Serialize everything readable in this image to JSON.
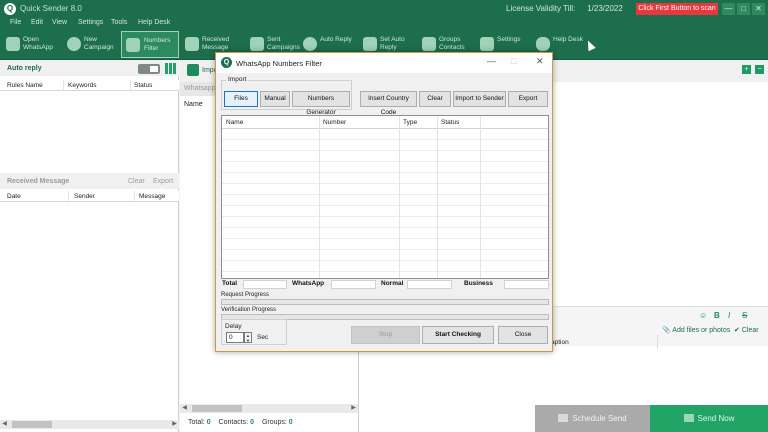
{
  "app": {
    "title": "Quick Sender 8.0",
    "logo_letter": "Q",
    "license_label": "License Validity Till:",
    "license_date": "1/23/2022",
    "scan_button": "Click First Button to scan",
    "window_controls": [
      "—",
      "□",
      "✕"
    ]
  },
  "menu": [
    "File",
    "Edit",
    "View",
    "Settings",
    "Tools",
    "Help Desk"
  ],
  "toolbar": {
    "items": [
      {
        "label": "Open\nWhatsApp",
        "icon": "qr-icon"
      },
      {
        "label": "New\nCampaign",
        "icon": "plus-circle-icon"
      },
      {
        "label": "Numbers\nFilter",
        "icon": "filter-icon"
      },
      {
        "label": "Received\nMessage",
        "icon": "inbox-icon"
      },
      {
        "label": "Sent\nCampaigns",
        "icon": "sent-icon"
      },
      {
        "label": "Auto Reply",
        "icon": "headset-icon"
      },
      {
        "label": "Set Auto\nReply",
        "icon": "settings-reply-icon"
      },
      {
        "label": "Groups\nContacts",
        "icon": "groups-icon"
      },
      {
        "label": "Settings",
        "icon": "sliders-icon"
      },
      {
        "label": "Help Desk",
        "icon": "cloud-icon"
      }
    ]
  },
  "left_panel": {
    "auto_reply": {
      "title": "Auto reply",
      "columns": [
        "Rules Name",
        "Keywords",
        "Status"
      ]
    },
    "received": {
      "title": "Received Message",
      "clear": "Clear",
      "export": "Export",
      "columns": [
        "Date",
        "Sender",
        "Message"
      ]
    }
  },
  "middle_panel": {
    "import_label": "Impo",
    "whatsapp_label": "Whatsapp",
    "name_label": "Name",
    "footer": {
      "total_label": "Total:",
      "total_value": "0",
      "contacts_label": "Contacts:",
      "contacts_value": "0",
      "groups_label": "Groups:",
      "groups_value": "0"
    }
  },
  "right_panel": {
    "format_icons": [
      "☺",
      "B",
      "I",
      "S"
    ],
    "attach": "Add files or photos",
    "clear": "Clear",
    "caption": "aption",
    "schedule": "Schedule Send",
    "send": "Send Now"
  },
  "dialog": {
    "title": "WhatsApp Numbers Filter",
    "controls": [
      "—",
      "□",
      "✕"
    ],
    "import_group": "Import",
    "buttons": {
      "files": "Files",
      "manual": "Manual",
      "generator": "Numbers Generator",
      "insert_code": "Insert Country Code",
      "clear": "Clear",
      "import_sender": "Import to Sender",
      "export": "Export",
      "stop": "Stop",
      "start": "Start Checking",
      "close": "Close"
    },
    "columns": [
      "Name",
      "Number",
      "Type",
      "Status"
    ],
    "totals": [
      "Total",
      "WhatsApp",
      "Normal",
      "Business"
    ],
    "request_progress": "Request Progress",
    "verification_progress": "Verification Progress",
    "delay_label": "Delay",
    "delay_value": "0",
    "delay_unit": "Sec"
  }
}
